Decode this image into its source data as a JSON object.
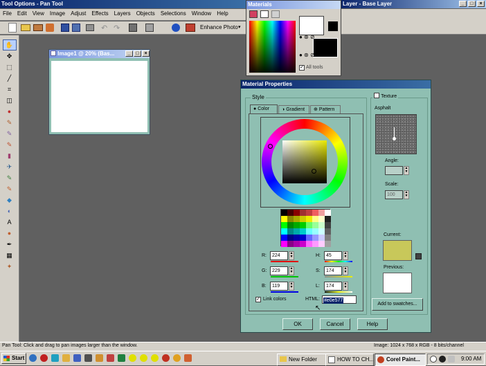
{
  "tool_options_title": "Tool Options - Pan Tool",
  "layer_title": "Layer - Base Layer",
  "menu": [
    "File",
    "Edit",
    "View",
    "Image",
    "Adjust",
    "Effects",
    "Layers",
    "Objects",
    "Selections",
    "Window",
    "Help"
  ],
  "toolbar": {
    "enhance_photo": "Enhance Photo"
  },
  "materials": {
    "title": "Materials",
    "all_tools": "All tools"
  },
  "image_window": {
    "title": "Image1 @  20% (Bas..."
  },
  "dialog": {
    "title": "Material Properties",
    "style_label": "Style",
    "tabs": [
      "Color",
      "Gradient",
      "Pattern"
    ],
    "texture_label": "Texture",
    "texture_name": "Asphalt",
    "angle_label": "Angle:",
    "angle_value": "",
    "scale_label": "Scale:",
    "scale_value": "100",
    "current_label": "Current:",
    "previous_label": "Previous:",
    "add_swatches": "Add to swatches...",
    "r_label": "R:",
    "r_value": "224",
    "g_label": "G:",
    "g_value": "229",
    "b_label": "B:",
    "b_value": "119",
    "h_label": "H:",
    "h_value": "45",
    "s_label": "S:",
    "s_value": "174",
    "l_label": "L:",
    "l_value": "174",
    "link_colors": "Link colors",
    "html_label": "HTML:",
    "html_value": "#e0e577",
    "ok": "OK",
    "cancel": "Cancel",
    "help": "Help",
    "current_color": "#c8c85a",
    "previous_color": "#ffffff"
  },
  "status": {
    "left": "Pan Tool: Click and drag to pan images larger than the window.",
    "right": "Image:  1024 x 768 x RGB - 8 bits/channel"
  },
  "taskbar": {
    "start": "Start",
    "buttons": [
      "New Folder",
      "HOW TO CH...",
      "Corel Paint..."
    ],
    "clock": "9:00 AM"
  }
}
